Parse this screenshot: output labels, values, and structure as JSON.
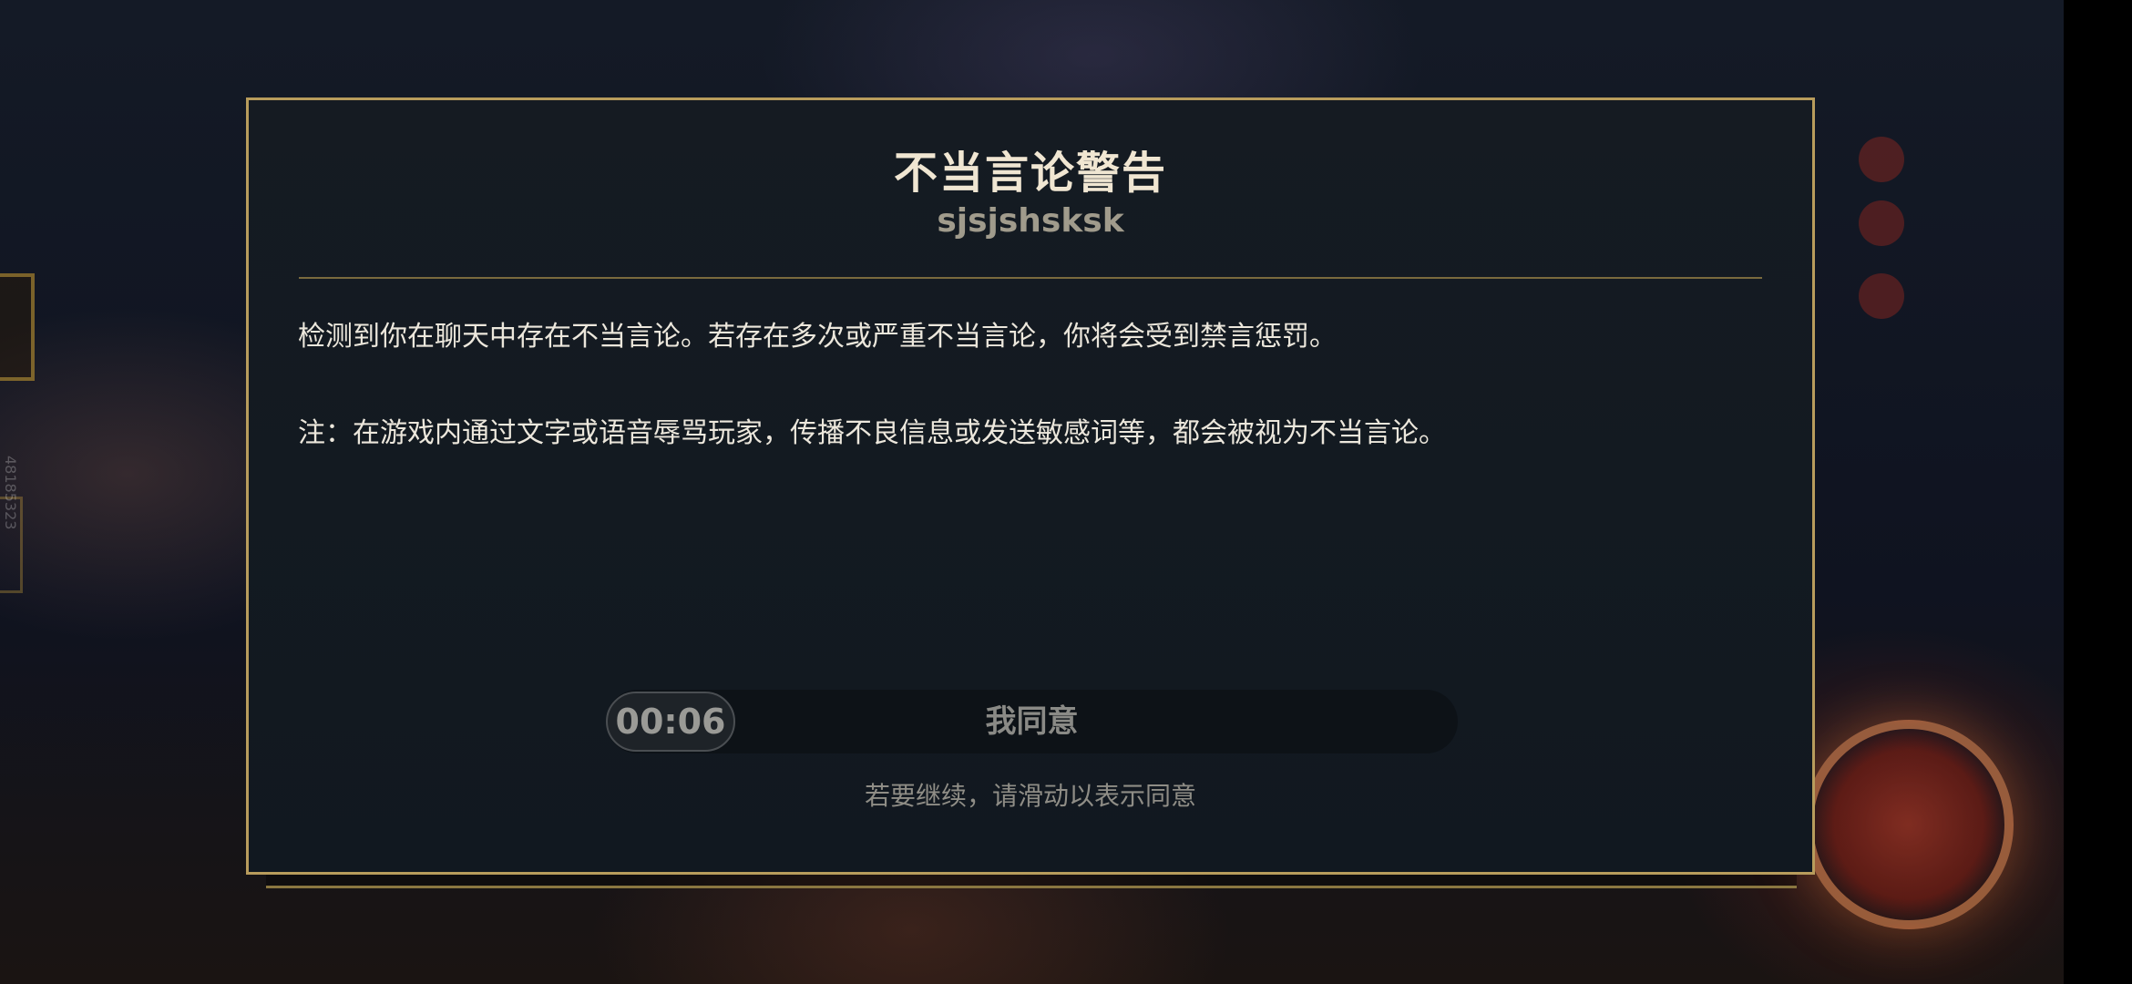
{
  "background": {
    "side_id": "48185323"
  },
  "dialog": {
    "title": "不当言论警告",
    "subtitle": "sjsjshsksk",
    "paragraph1": "检测到你在聊天中存在不当言论。若存在多次或严重不当言论，你将会受到禁言惩罚。",
    "paragraph2": "注：在游戏内通过文字或语音辱骂玩家，传播不良信息或发送敏感词等，都会被视为不当言论。",
    "slider": {
      "timer": "00:06",
      "label": "我同意"
    },
    "hint": "若要继续，请滑动以表示同意"
  },
  "colors": {
    "border_gold": "#b89c5c",
    "title_text": "#f0e6d2",
    "dialog_bg": "#151b22"
  }
}
